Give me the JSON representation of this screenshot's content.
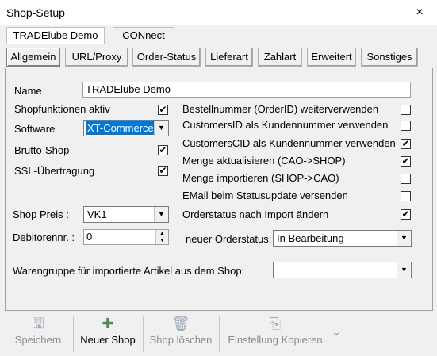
{
  "window": {
    "title": "Shop-Setup",
    "close_glyph": "×"
  },
  "top_tabs": [
    {
      "label": "TRADElube Demo",
      "active": true
    },
    {
      "label": "CONnect",
      "active": false
    }
  ],
  "sub_tabs": [
    {
      "label": "Allgemein",
      "active": true
    },
    {
      "label": "URL/Proxy",
      "active": false
    },
    {
      "label": "Order-Status",
      "active": false
    },
    {
      "label": "Lieferart",
      "active": false
    },
    {
      "label": "Zahlart",
      "active": false
    },
    {
      "label": "Erweitert",
      "active": false
    },
    {
      "label": "Sonstiges",
      "active": false
    }
  ],
  "form": {
    "name_label": "Name",
    "name_value": "TRADElube Demo",
    "shopfunktionen_label": "Shopfunktionen aktiv",
    "shopfunktionen_checked": true,
    "software_label": "Software",
    "software_value": "XT-Commerce",
    "brutto_label": "Brutto-Shop",
    "brutto_checked": true,
    "ssl_label": "SSL-Übertragung",
    "ssl_checked": true,
    "shop_preis_label": "Shop Preis :",
    "shop_preis_value": "VK1",
    "debitor_label": "Debitorennr. :",
    "debitor_value": "0",
    "warengruppe_label": "Warengruppe für importierte Artikel aus dem Shop:",
    "warengruppe_value": "",
    "options": [
      {
        "label": "Bestellnummer (OrderID) weiterverwenden",
        "checked": false
      },
      {
        "label": "CustomersID als Kundennummer verwenden",
        "checked": false
      },
      {
        "label": "CustomersCID als Kundennummer verwenden",
        "checked": true
      },
      {
        "label": "Menge aktualisieren (CAO->SHOP)",
        "checked": true
      },
      {
        "label": "Menge importieren (SHOP->CAO)",
        "checked": false
      },
      {
        "label": "EMail beim Statusupdate versenden",
        "checked": false
      },
      {
        "label": "Orderstatus nach Import ändern",
        "checked": true
      }
    ],
    "neuer_status_label": "neuer Orderstatus:",
    "neuer_status_value": "In Bearbeitung"
  },
  "toolbar": [
    {
      "label": "Speichern",
      "icon": "save-icon",
      "glyph": "🖫",
      "enabled": false
    },
    {
      "label": "Neuer Shop",
      "icon": "plus-icon",
      "glyph": "✚",
      "enabled": true
    },
    {
      "label": "Shop löschen",
      "icon": "trash-icon",
      "glyph": "🗑",
      "enabled": false
    },
    {
      "label": "Einstellung Kopieren",
      "icon": "copy-icon",
      "glyph": "⎘",
      "enabled": false
    }
  ],
  "toolbar_more_glyph": "⌄",
  "check_glyph": "✔",
  "dropdown_glyph": "▼"
}
